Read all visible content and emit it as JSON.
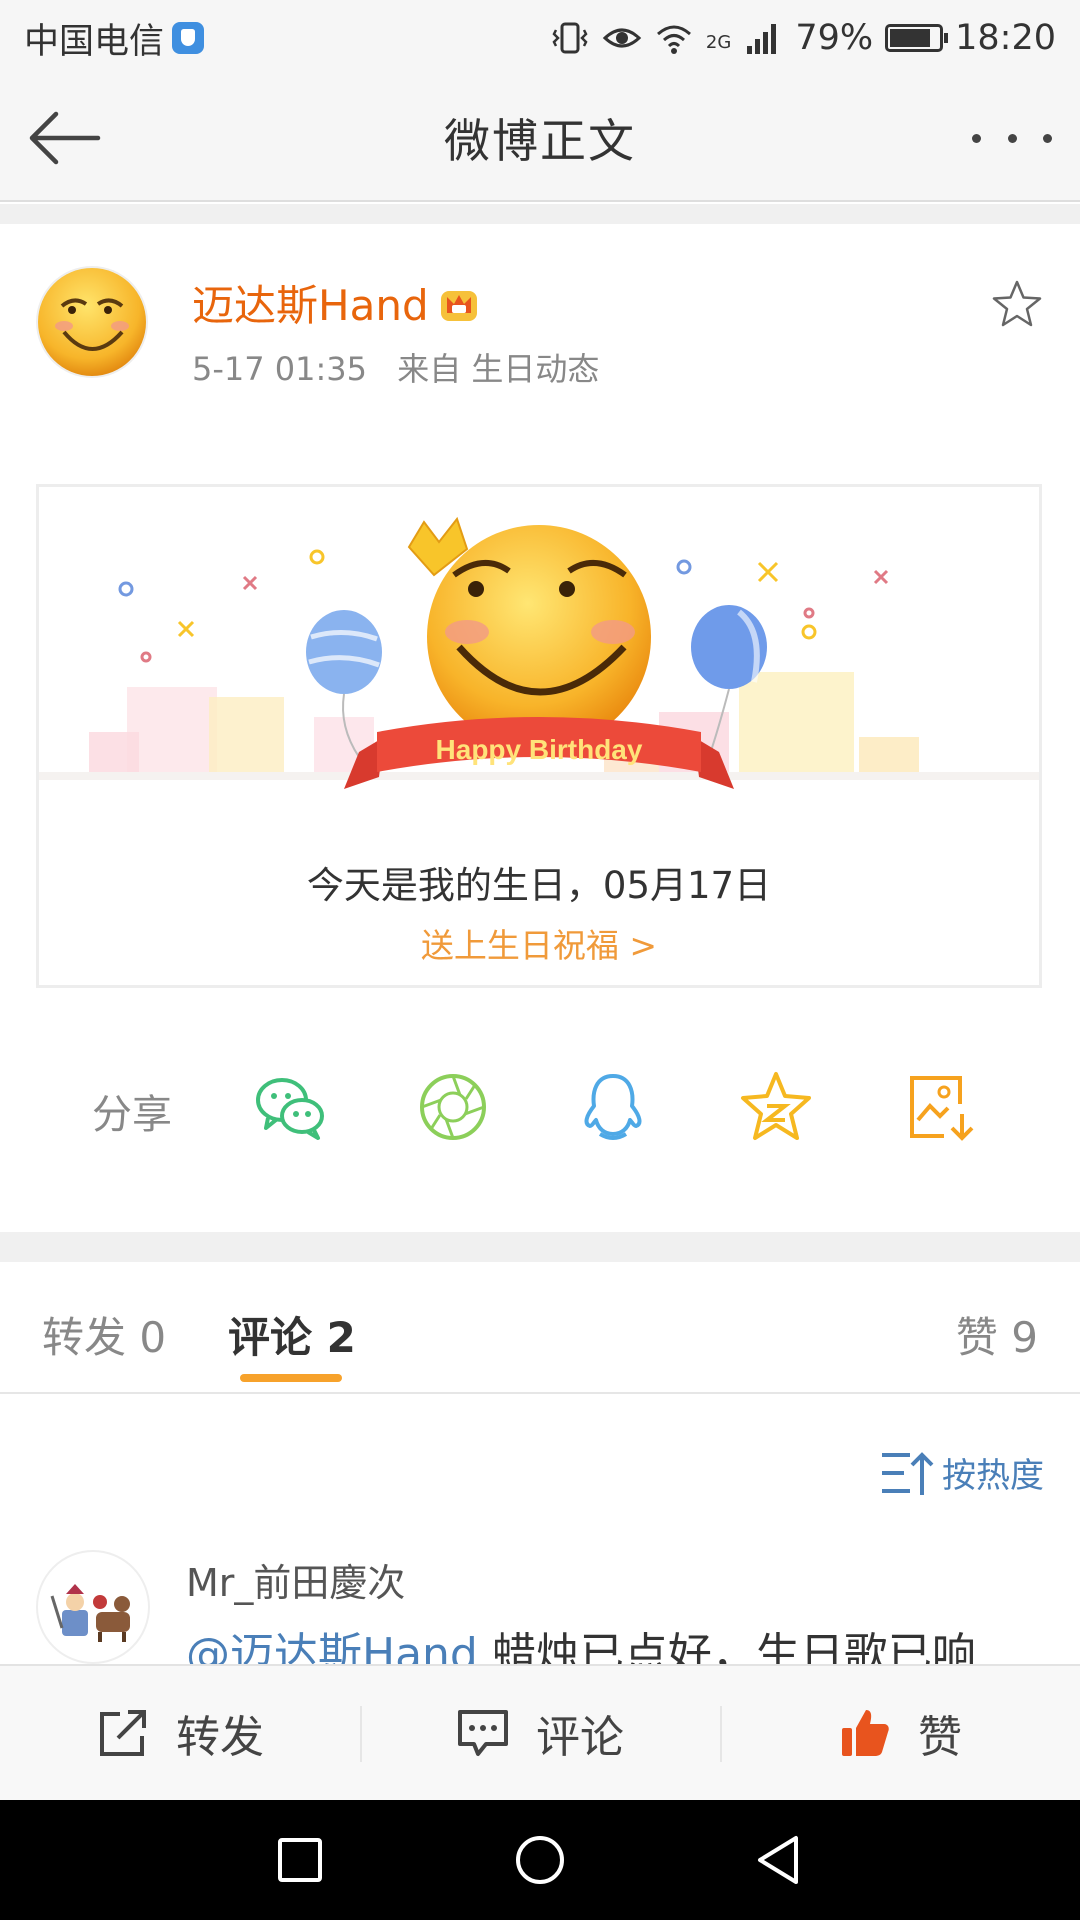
{
  "status_bar": {
    "carrier": "中国电信",
    "network": "2G",
    "battery": "79%",
    "time": "18:20"
  },
  "header": {
    "title": "微博正文",
    "back_icon": "arrow-left-icon",
    "more_icon": "more-dots-icon"
  },
  "post": {
    "author": "迈达斯Hand",
    "time": "5-17 01:35",
    "source": "来自 生日动态",
    "birthday_card": {
      "banner_text": "Happy Birthday",
      "message": "今天是我的生日，05月17日",
      "link": "送上生日祝福 >"
    }
  },
  "share": {
    "label": "分享",
    "icons": [
      "wechat-icon",
      "moments-icon",
      "qq-icon",
      "qzone-icon",
      "save-image-icon"
    ]
  },
  "tabs": {
    "repost": "转发 0",
    "comment": "评论 2",
    "like": "赞 9"
  },
  "sort": {
    "label": "按热度"
  },
  "comments": [
    {
      "user": "Mr_前田慶次",
      "mention": "@迈达斯Hand",
      "text": " 蜡烛已点好，生日歌已响"
    }
  ],
  "action_bar": {
    "repost": "转发",
    "comment": "评论",
    "like": "赞"
  },
  "colors": {
    "accent": "#f7a22b",
    "author_name": "#e8650c",
    "link_blue": "#4a7fb8",
    "like_red": "#e8541e"
  }
}
